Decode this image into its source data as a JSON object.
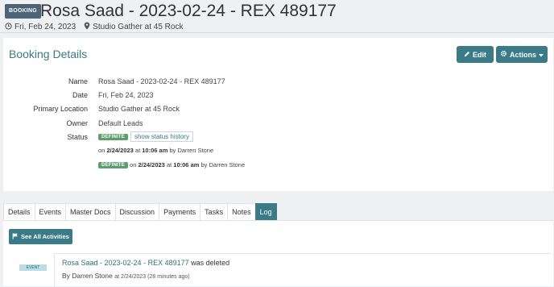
{
  "header": {
    "badge": "BOOKING",
    "title": "Rosa Saad - 2023-02-24 - REX 489177",
    "date": "Fri, Feb 24, 2023",
    "location": "Studio Gather at 45 Rock"
  },
  "panel": {
    "title": "Booking Details",
    "edit_label": "Edit",
    "actions_label": "Actions",
    "fields": {
      "name_label": "Name",
      "name_value": "Rosa Saad - 2023-02-24 - REX 489177",
      "date_label": "Date",
      "date_value": "Fri, Feb 24, 2023",
      "location_label": "Primary Location",
      "location_value": "Studio Gather at 45 Rock",
      "owner_label": "Owner",
      "owner_value": "Default Leads",
      "status_label": "Status",
      "status_value": "DEFINITE",
      "status_history_link": "show status history",
      "status_entry1_prefix": "on",
      "status_entry1_date": "2/24/2023",
      "status_entry1_at": "at",
      "status_entry1_time": "10:06 am",
      "status_entry1_by": "by Darren Stone",
      "status_entry2_badge": "DEFINITE",
      "status_entry2_prefix": "on",
      "status_entry2_date": "2/24/2023",
      "status_entry2_at": "at",
      "status_entry2_time": "10:06 am",
      "status_entry2_by": "by Darren Stone"
    }
  },
  "tabs": [
    {
      "label": "Details"
    },
    {
      "label": "Events"
    },
    {
      "label": "Master Docs"
    },
    {
      "label": "Discussion"
    },
    {
      "label": "Payments"
    },
    {
      "label": "Tasks"
    },
    {
      "label": "Notes"
    },
    {
      "label": "Log",
      "active": true
    }
  ],
  "log": {
    "see_all_label": "See All Activities",
    "event_tag": "EVENT",
    "item_link": "Rosa Saad - 2023-02-24 - REX 489177",
    "item_suffix": "was deleted",
    "item_by": "By Darren Stone",
    "item_meta": "at 2/24/2023 (28 minutes ago)"
  },
  "colors": {
    "accent": "#3b7a87",
    "status_green": "#5e9e6b",
    "badge_dark": "#4b6478"
  }
}
